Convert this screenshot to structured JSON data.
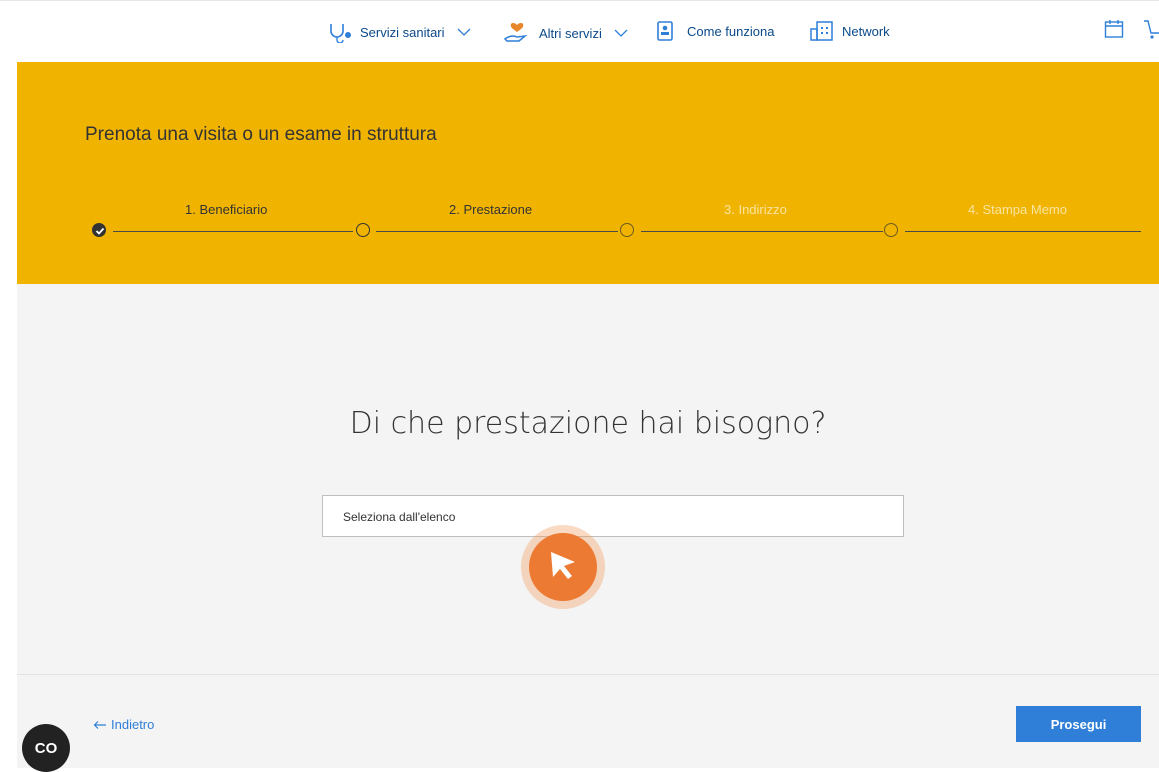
{
  "nav": {
    "items": [
      {
        "label": "Servizi sanitari",
        "icon": "stethoscope-icon",
        "dropdown": true
      },
      {
        "label": "Altri servizi",
        "icon": "hand-heart-icon",
        "dropdown": true
      },
      {
        "label": "Come funziona",
        "icon": "info-card-icon",
        "dropdown": false
      },
      {
        "label": "Network",
        "icon": "building-icon",
        "dropdown": false
      }
    ],
    "right_icons": [
      "calendar-icon",
      "cart-icon"
    ]
  },
  "hero": {
    "title": "Prenota una visita o un esame in struttura",
    "steps": [
      {
        "label": "1. Beneficiario",
        "state": "done"
      },
      {
        "label": "2. Prestazione",
        "state": "current"
      },
      {
        "label": "3. Indirizzo",
        "state": "todo"
      },
      {
        "label": "4. Stampa Memo",
        "state": "todo"
      }
    ]
  },
  "main": {
    "question": "Di che prestazione hai bisogno?",
    "select_placeholder": "Seleziona dall'elenco"
  },
  "footer": {
    "back_label": "Indietro",
    "next_label": "Prosegui"
  },
  "chat": {
    "label": "CO"
  },
  "colors": {
    "hero_bg": "#f0b400",
    "primary": "#2f7fd8",
    "cursor": "#ec7a32"
  }
}
